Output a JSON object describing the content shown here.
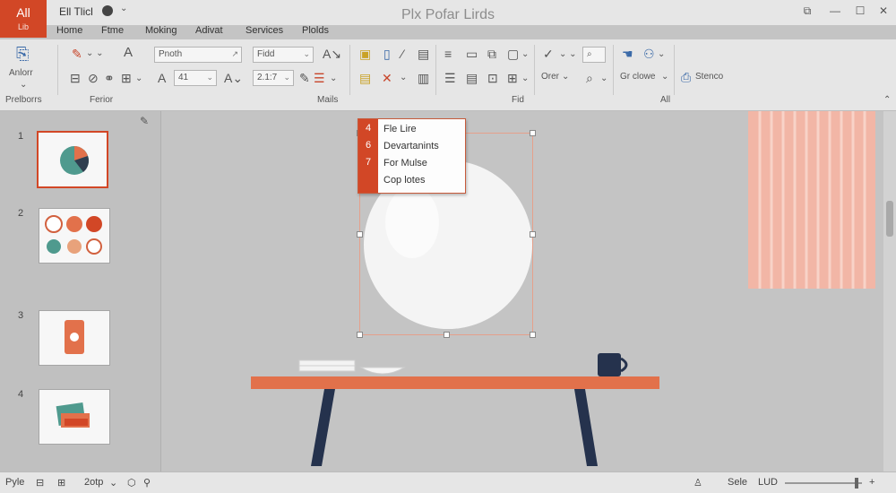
{
  "app": {
    "badge_top": "All",
    "badge_sub": "Lib",
    "doc_title": "Ell Tlicl",
    "window_title": "Plx Pofar Lirds"
  },
  "menu_tabs": [
    "Home",
    "Ftme",
    "Moking",
    "Adivat",
    "Services",
    "Plolds"
  ],
  "ribbon": {
    "group1_label": "Anlorr",
    "font_name": "Pnoth",
    "font_size": "41",
    "field1": "Fidd",
    "field2": "2.1:7",
    "order_label": "Orer",
    "overflow_label": "Gr clowe",
    "share_label": "Stenco",
    "group_labels": [
      "Prelborrs",
      "Ferior",
      "Mails",
      "Fid",
      "All"
    ]
  },
  "slides": [
    "1",
    "2",
    "3",
    "4"
  ],
  "context_menu": [
    {
      "num": "4",
      "label": "Fle Lire"
    },
    {
      "num": "6",
      "label": "Devartanints"
    },
    {
      "num": "7",
      "label": "For Mulse"
    },
    {
      "num": "",
      "label": "Cop lotes"
    }
  ],
  "status": {
    "left": "Pyle",
    "zoom": "2otp",
    "right": "Sele",
    "right2": "LUD"
  },
  "colors": {
    "accent": "#d24726",
    "table_top": "#e2714b",
    "table_legs": "#25324d",
    "curtain": "#f2b6a6",
    "mug": "#25324d"
  }
}
